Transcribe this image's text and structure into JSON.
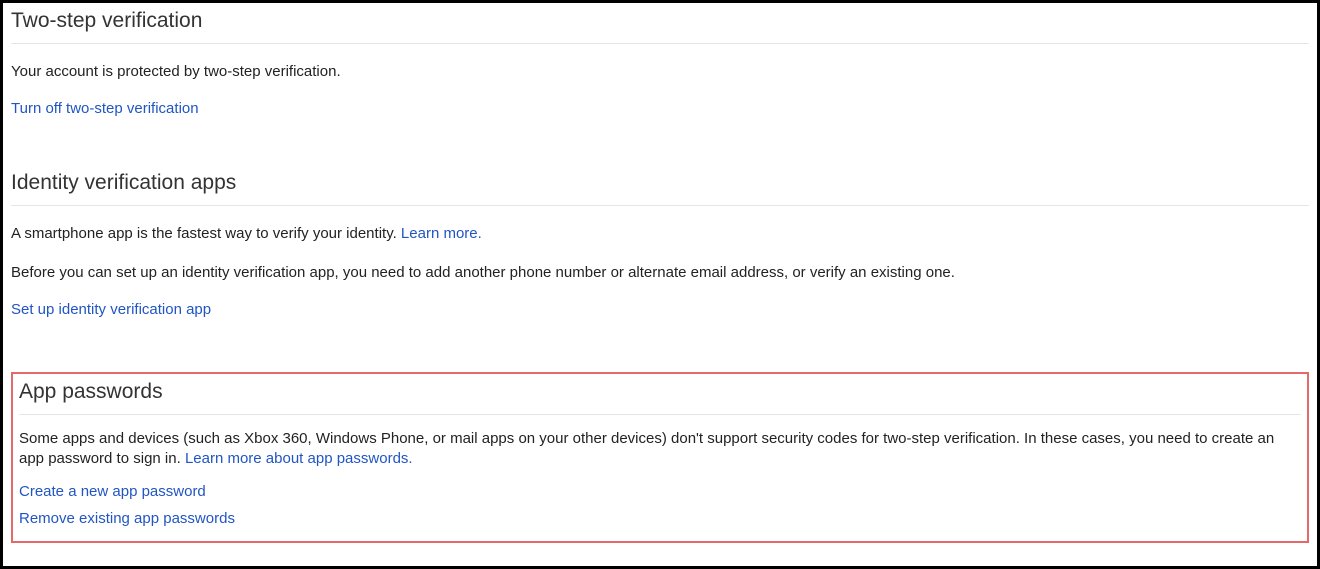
{
  "twoStep": {
    "title": "Two-step verification",
    "description": "Your account is protected by two-step verification.",
    "turnOffLink": "Turn off two-step verification"
  },
  "identityApps": {
    "title": "Identity verification apps",
    "line1_prefix": "A smartphone app is the fastest way to verify your identity. ",
    "line1_link": "Learn more.",
    "line2": "Before you can set up an identity verification app, you need to add another phone number or alternate email address, or verify an existing one.",
    "setupLink": "Set up identity verification app"
  },
  "appPasswords": {
    "title": "App passwords",
    "desc_prefix": "Some apps and devices (such as Xbox 360, Windows Phone, or mail apps on your other devices) don't support security codes for two-step verification. In these cases, you need to create an app password to sign in. ",
    "desc_link": "Learn more about app passwords.",
    "createLink": "Create a new app password",
    "removeLink": "Remove existing app passwords"
  }
}
